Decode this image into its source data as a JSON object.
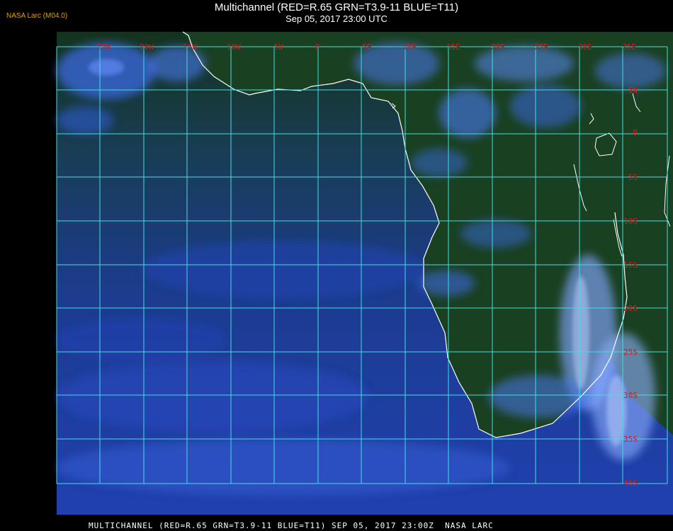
{
  "header": {
    "title": "Multichannel (RED=R.65 GRN=T3.9-11 BLUE=T11)",
    "subtitle": "Sep 05, 2017 23:00 UTC",
    "badge": "NASA Larc (M04.0)"
  },
  "footer": {
    "text": "MULTICHANNEL (RED=R.65 GRN=T3.9-11 BLUE=T11) SEP 05, 2017 23:00Z  NASA LARC"
  },
  "map": {
    "lon_labels": [
      "25W",
      "20W",
      "15W",
      "10W",
      "5W",
      "0",
      "5E",
      "10E",
      "15E",
      "20E",
      "25E",
      "30E",
      "35E"
    ],
    "lat_labels": [
      "5N",
      "0",
      "5S",
      "10S",
      "15S",
      "20S",
      "25S",
      "30S",
      "35S",
      "40S"
    ],
    "colors": {
      "grid": "#40e0e0",
      "label": "#cc2020",
      "coast": "#ffffff",
      "ocean": "#1c3c98",
      "land": "#1a3f22",
      "cloud": "#4a78f0",
      "high_cloud": "#8fb0ff"
    }
  }
}
